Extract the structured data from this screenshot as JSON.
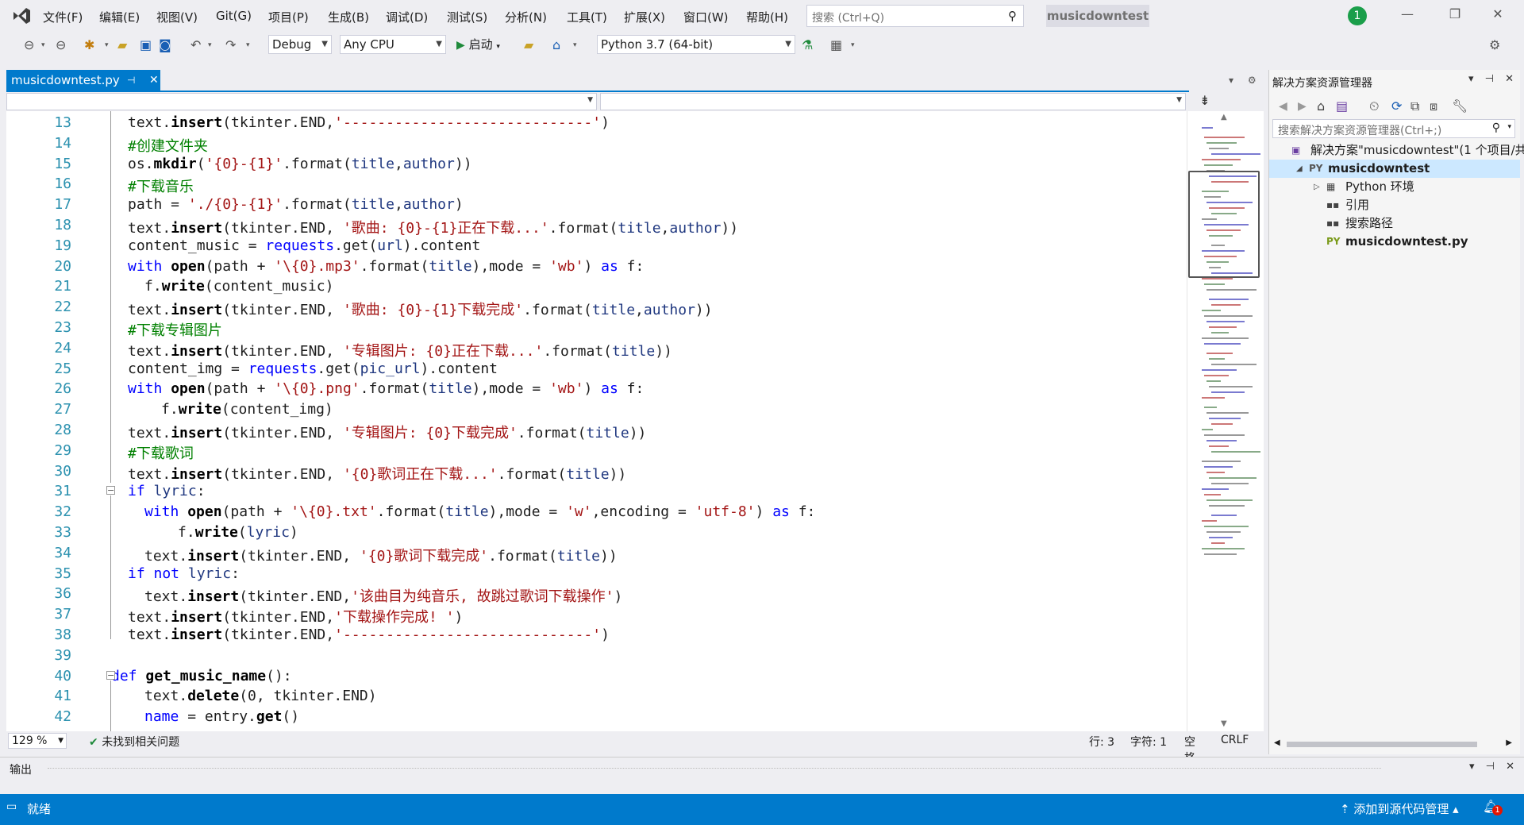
{
  "menubar": {
    "items": [
      "文件(F)",
      "编辑(E)",
      "视图(V)",
      "Git(G)",
      "项目(P)",
      "生成(B)",
      "调试(D)",
      "测试(S)",
      "分析(N)",
      "工具(T)",
      "扩展(X)",
      "窗口(W)",
      "帮助(H)"
    ],
    "search_placeholder": "搜索 (Ctrl+Q)",
    "project_title": "musicdowntest",
    "user_badge": "1"
  },
  "toolbar": {
    "config": "Debug",
    "platform": "Any CPU",
    "run_label": "启动",
    "environment": "Python 3.7 (64-bit)"
  },
  "document_tab": {
    "filename": "musicdowntest.py"
  },
  "editor": {
    "lines": [
      {
        "n": "13",
        "indent": 1,
        "html": "text.<b class='bold'>insert</b>(tkinter.END,<span class='str'>'-----------------------------'</span>)"
      },
      {
        "n": "14",
        "indent": 1,
        "html": "<span class='cm'>#创建文件夹</span>"
      },
      {
        "n": "15",
        "indent": 1,
        "html": "os.<b class='bold'>mkdir</b>(<span class='str'>'{0}-{1}'</span>.format(<span class='pr'>title</span>,<span class='pr'>author</span>))"
      },
      {
        "n": "16",
        "indent": 1,
        "html": "<span class='cm'>#下载音乐</span>"
      },
      {
        "n": "17",
        "indent": 1,
        "html": "path = <span class='str'>'./{0}-{1}'</span>.format(<span class='pr'>title</span>,<span class='pr'>author</span>)"
      },
      {
        "n": "18",
        "indent": 1,
        "html": "text.<b class='bold'>insert</b>(tkinter.END, <span class='str'>'歌曲: {0}-{1}正在下载...'</span>.format(<span class='pr'>title</span>,<span class='pr'>author</span>))"
      },
      {
        "n": "19",
        "indent": 1,
        "html": "content_music = <span class='kw'>requests</span>.get(<span class='pr'>url</span>).content"
      },
      {
        "n": "20",
        "indent": 1,
        "html": "<span class='kw'>with</span> <b class='bold'>open</b>(path + <span class='str'>'\\{0}.mp3'</span>.format(<span class='pr'>title</span>),mode = <span class='str'>'wb'</span>) <span class='kw'>as</span> f:"
      },
      {
        "n": "21",
        "indent": 2,
        "html": "f.<b class='bold'>write</b>(content_music)"
      },
      {
        "n": "22",
        "indent": 1,
        "html": "text.<b class='bold'>insert</b>(tkinter.END, <span class='str'>'歌曲: {0}-{1}下载完成'</span>.format(<span class='pr'>title</span>,<span class='pr'>author</span>))"
      },
      {
        "n": "23",
        "indent": 1,
        "html": "<span class='cm'>#下载专辑图片</span>"
      },
      {
        "n": "24",
        "indent": 1,
        "html": "text.<b class='bold'>insert</b>(tkinter.END, <span class='str'>'专辑图片: {0}正在下载...'</span>.format(<span class='pr'>title</span>))"
      },
      {
        "n": "25",
        "indent": 1,
        "html": "content_img = <span class='kw'>requests</span>.get(<span class='pr'>pic_url</span>).content"
      },
      {
        "n": "26",
        "indent": 1,
        "html": "<span class='kw'>with</span> <b class='bold'>open</b>(path + <span class='str'>'\\{0}.png'</span>.format(<span class='pr'>title</span>),mode = <span class='str'>'wb'</span>) <span class='kw'>as</span> f:"
      },
      {
        "n": "27",
        "indent": 3,
        "html": "f.<b class='bold'>write</b>(content_img)"
      },
      {
        "n": "28",
        "indent": 1,
        "html": "text.<b class='bold'>insert</b>(tkinter.END, <span class='str'>'专辑图片: {0}下载完成'</span>.format(<span class='pr'>title</span>))"
      },
      {
        "n": "29",
        "indent": 1,
        "html": "<span class='cm'>#下载歌词</span>"
      },
      {
        "n": "30",
        "indent": 1,
        "html": "text.<b class='bold'>insert</b>(tkinter.END, <span class='str'>'{0}歌词正在下载...'</span>.format(<span class='pr'>title</span>))"
      },
      {
        "n": "31",
        "indent": 1,
        "html": "<span class='kw'>if</span> <span class='pr'>lyric</span>:"
      },
      {
        "n": "32",
        "indent": 2,
        "html": "<span class='kw'>with</span> <b class='bold'>open</b>(path + <span class='str'>'\\{0}.txt'</span>.format(<span class='pr'>title</span>),mode = <span class='str'>'w'</span>,encoding = <span class='str'>'utf-8'</span>) <span class='kw'>as</span> f:"
      },
      {
        "n": "33",
        "indent": 4,
        "html": "f.<b class='bold'>write</b>(<span class='pr'>lyric</span>)"
      },
      {
        "n": "34",
        "indent": 2,
        "html": "text.<b class='bold'>insert</b>(tkinter.END, <span class='str'>'{0}歌词下载完成'</span>.format(<span class='pr'>title</span>))"
      },
      {
        "n": "35",
        "indent": 1,
        "html": "<span class='kw'>if not</span> <span class='pr'>lyric</span>:"
      },
      {
        "n": "36",
        "indent": 2,
        "html": "text.<b class='bold'>insert</b>(tkinter.END,<span class='str'>'该曲目为纯音乐, 故跳过歌词下载操作'</span>)"
      },
      {
        "n": "37",
        "indent": 1,
        "html": "text.<b class='bold'>insert</b>(tkinter.END,<span class='str'>'下载操作完成! '</span>)"
      },
      {
        "n": "38",
        "indent": 1,
        "html": "text.<b class='bold'>insert</b>(tkinter.END,<span class='str'>'-----------------------------'</span>)"
      },
      {
        "n": "39",
        "indent": 0,
        "html": ""
      },
      {
        "n": "40",
        "indent": 0,
        "html": "<span class='kw'>def</span> <b class='bold'>get_music_name</b>():"
      },
      {
        "n": "41",
        "indent": 2,
        "html": "text.<b class='bold'>delete</b>(0, tkinter.END)"
      },
      {
        "n": "42",
        "indent": 2,
        "html": "<span class='kw'>name</span> = entry.<b class='bold'>get</b>()"
      }
    ]
  },
  "editor_status": {
    "zoom": "129 %",
    "issues": "未找到相关问题",
    "line": "行: 3",
    "char": "字符: 1",
    "spaces": "空格",
    "eol": "CRLF"
  },
  "solution_explorer": {
    "title": "解决方案资源管理器",
    "search_placeholder": "搜索解决方案资源管理器(Ctrl+;)",
    "items": [
      {
        "label": "解决方案\"musicdowntest\"(1 个项目/共",
        "level": 0,
        "icon": "solution-icon",
        "bold": false,
        "selected": false,
        "expander": ""
      },
      {
        "label": "musicdowntest",
        "level": 1,
        "icon": "python-project-icon",
        "bold": true,
        "selected": true,
        "expander": "◢"
      },
      {
        "label": "Python 环境",
        "level": 2,
        "icon": "python-env-icon",
        "bold": false,
        "selected": false,
        "expander": "▷"
      },
      {
        "label": "引用",
        "level": 2,
        "icon": "references-icon",
        "bold": false,
        "selected": false,
        "expander": ""
      },
      {
        "label": "搜索路径",
        "level": 2,
        "icon": "search-paths-icon",
        "bold": false,
        "selected": false,
        "expander": ""
      },
      {
        "label": "musicdowntest.py",
        "level": 2,
        "icon": "python-file-icon",
        "bold": true,
        "selected": false,
        "expander": ""
      }
    ]
  },
  "output_panel": {
    "title": "输出"
  },
  "statusbar": {
    "ready": "就绪",
    "source_control": "添加到源代码管理",
    "notifications": "1"
  },
  "colors": {
    "accent": "#007acc",
    "keyword": "#0000ff",
    "string": "#a31515",
    "comment": "#008000",
    "line_number": "#2b91af"
  }
}
